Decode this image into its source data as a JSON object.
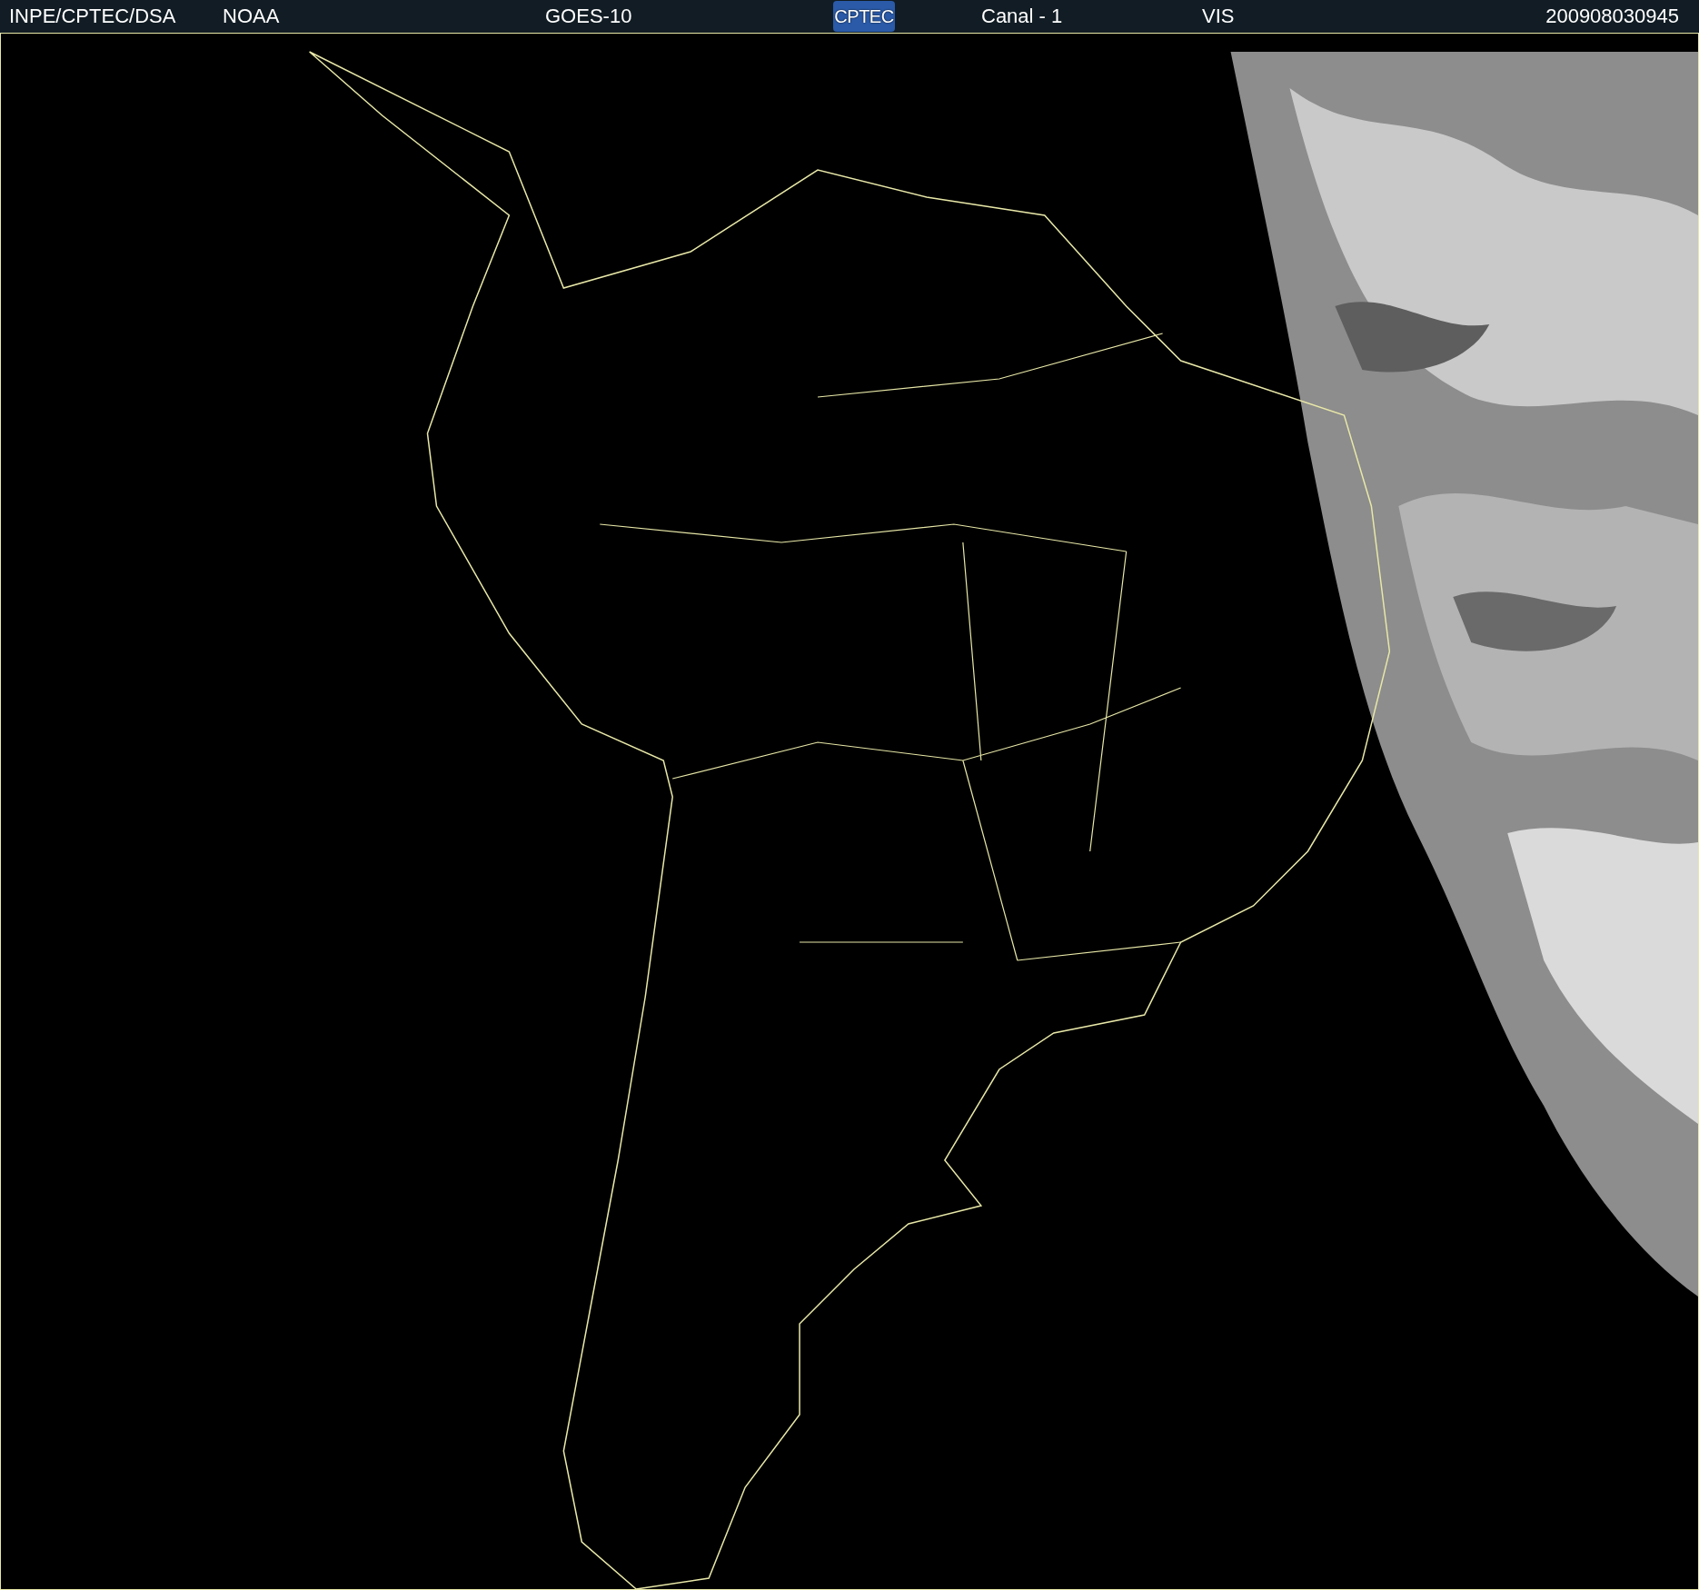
{
  "header": {
    "institution": "INPE/CPTEC/DSA",
    "agency": "NOAA",
    "satellite": "GOES-10",
    "logo": "CPTEC",
    "channel": "Canal - 1",
    "band": "VIS",
    "timestamp": "200908030945"
  }
}
